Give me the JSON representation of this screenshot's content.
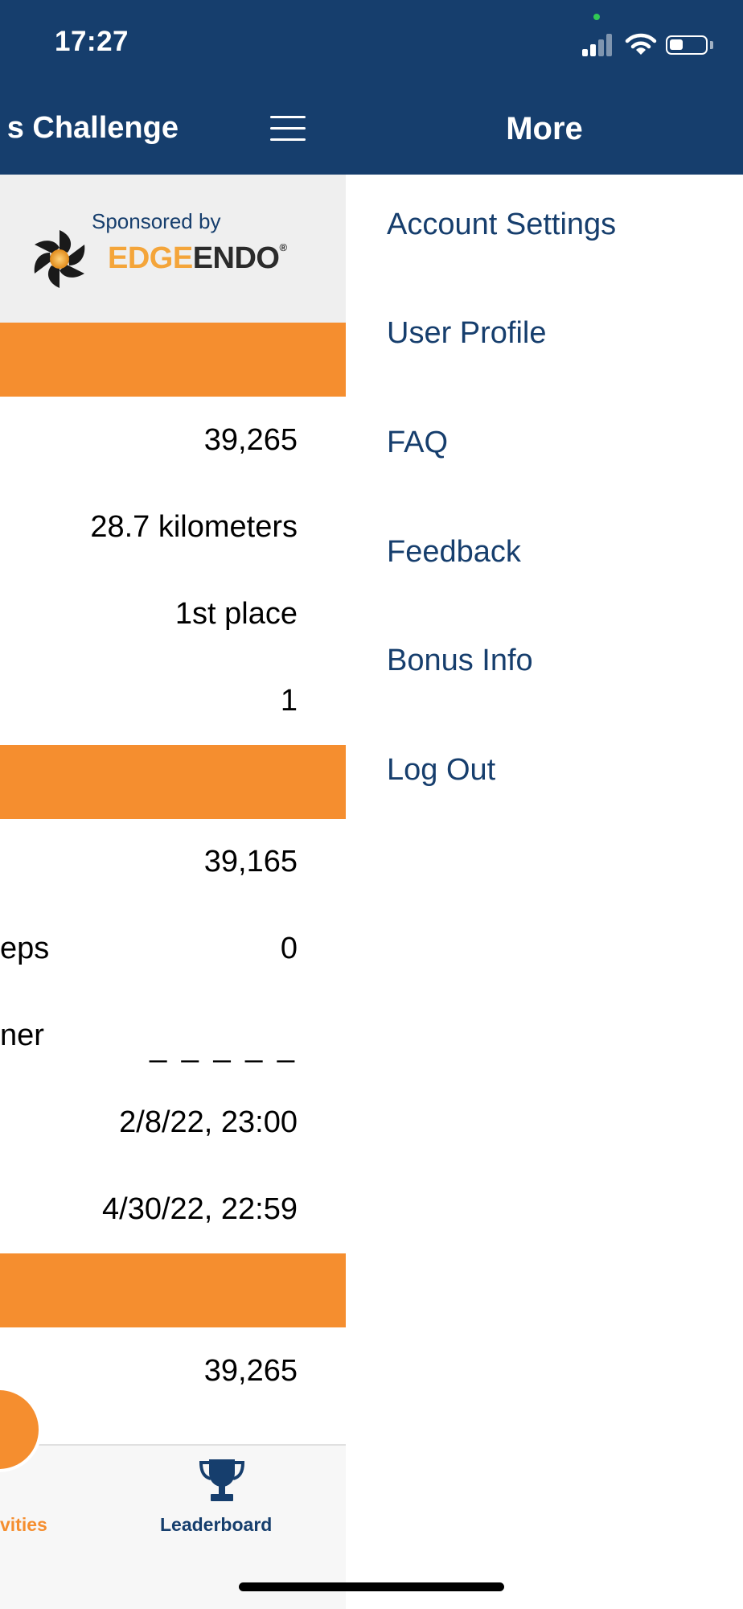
{
  "status_bar": {
    "time": "17:27"
  },
  "left_panel": {
    "header_title": "s Challenge",
    "sponsor": {
      "sponsored_by": "Sponsored by",
      "brand_edge": "EDGE",
      "brand_endo": "ENDO",
      "registered": "®"
    },
    "rows": [
      {
        "label": "",
        "value": "39,265"
      },
      {
        "label": "",
        "value": "28.7 kilometers"
      },
      {
        "label": "",
        "value": "1st place"
      },
      {
        "label": "",
        "value": "1"
      },
      {
        "label": "",
        "value": "39,165"
      },
      {
        "label": "eps",
        "value": "0"
      },
      {
        "label": "ner",
        "value": "_ _ _ _ _"
      },
      {
        "label": "",
        "value": "2/8/22, 23:00"
      },
      {
        "label": "",
        "value": "4/30/22, 22:59"
      },
      {
        "label": "",
        "value": "39,265"
      }
    ],
    "tabs": {
      "activities": "vities",
      "leaderboard": "Leaderboard"
    }
  },
  "drawer": {
    "title": "More",
    "items": [
      {
        "label": "Account Settings"
      },
      {
        "label": "User Profile"
      },
      {
        "label": "FAQ"
      },
      {
        "label": "Feedback"
      },
      {
        "label": "Bonus Info"
      },
      {
        "label": "Log Out"
      }
    ]
  },
  "colors": {
    "navy": "#163e6d",
    "orange": "#f58e2f",
    "brand_gold": "#f4a53a"
  },
  "icons": [
    "hamburger-menu-icon",
    "signal-icon",
    "wifi-icon",
    "battery-icon",
    "activities-icon",
    "trophy-icon",
    "edgeendo-logo"
  ]
}
